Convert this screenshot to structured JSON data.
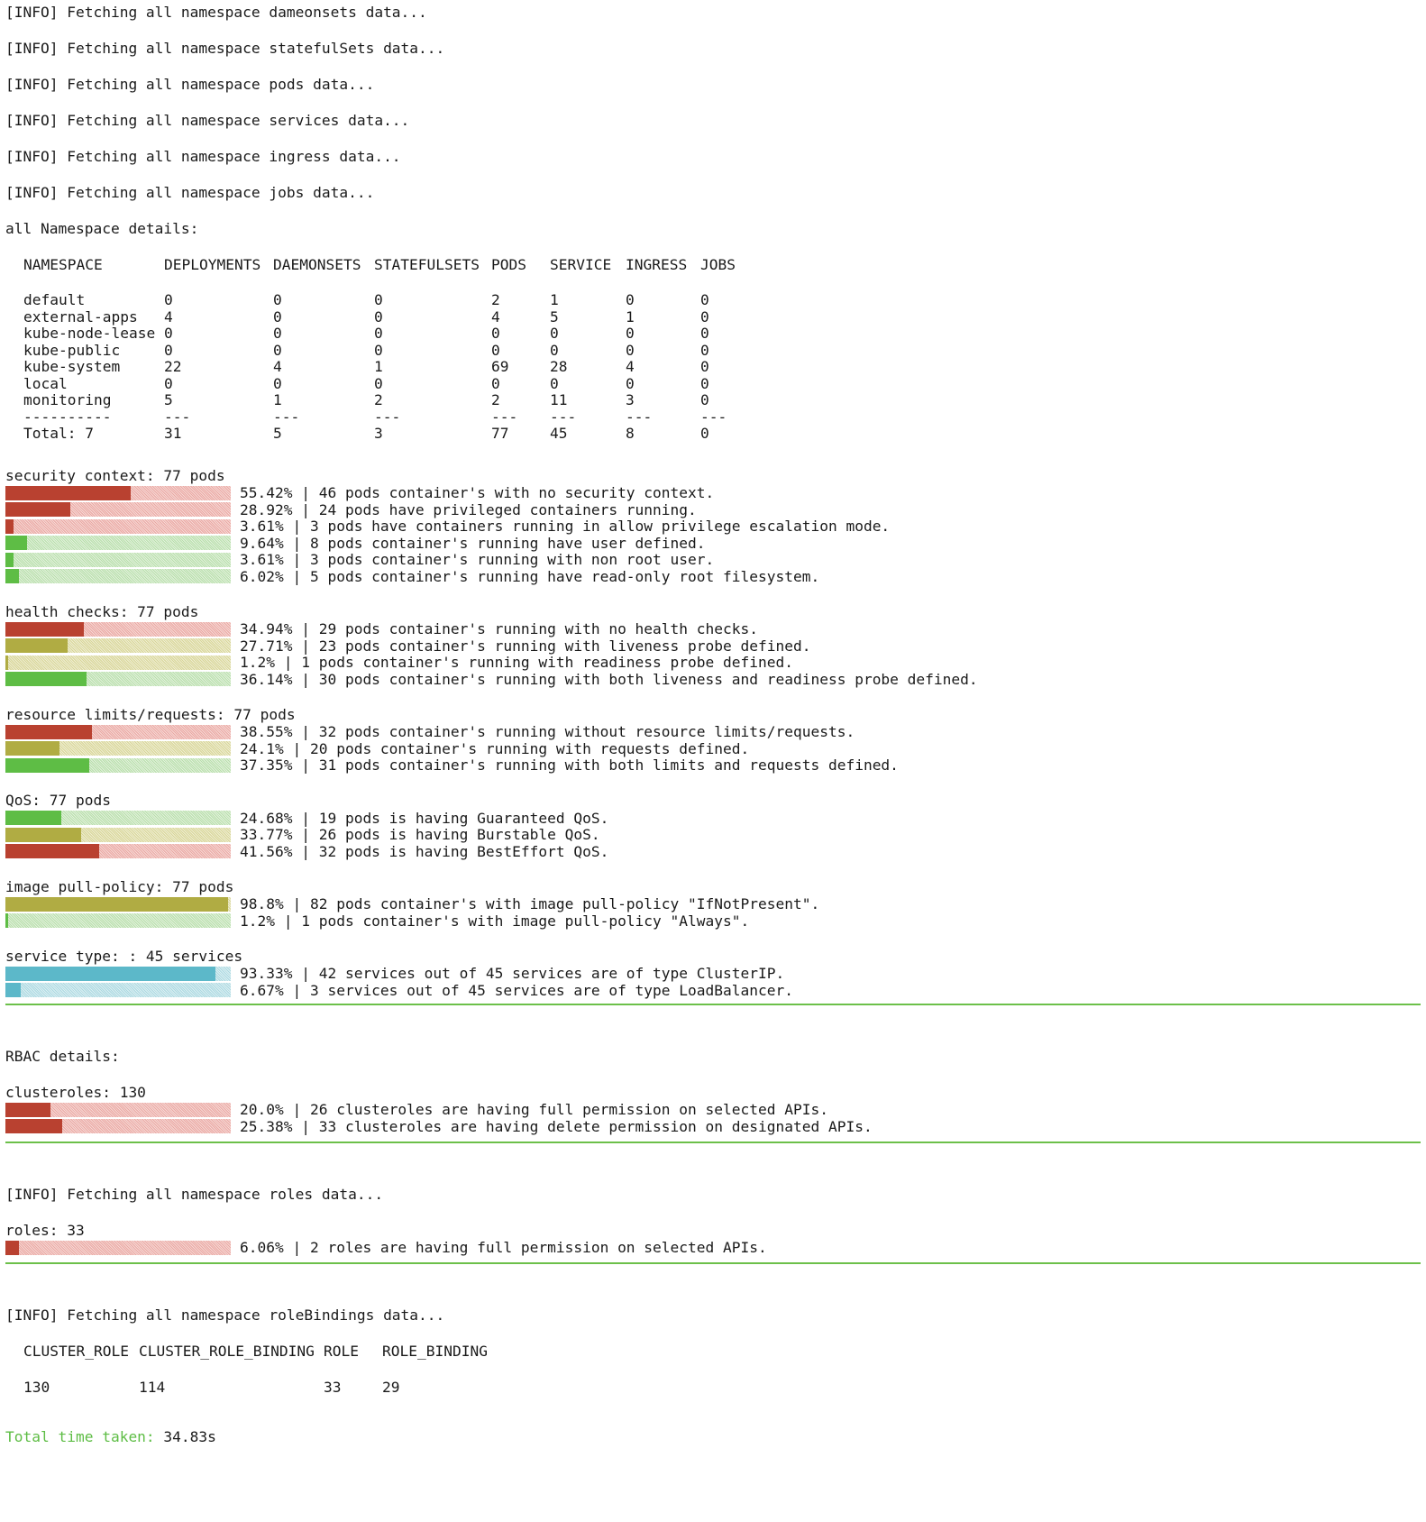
{
  "colors": {
    "red": "#b94130",
    "green": "#5ebd45",
    "olive": "#b0ac43",
    "cyan": "#5cb8c9",
    "separator": "#6cc04a"
  },
  "info_lines": [
    "[INFO] Fetching all namespace dameonsets data...",
    "[INFO] Fetching all namespace statefulSets data...",
    "[INFO] Fetching all namespace pods data...",
    "[INFO] Fetching all namespace services data...",
    "[INFO] Fetching all namespace ingress data...",
    "[INFO] Fetching all namespace jobs data..."
  ],
  "ns_title": "all Namespace details:",
  "ns_table": {
    "headers": [
      "NAMESPACE",
      "DEPLOYMENTS",
      "DAEMONSETS",
      "STATEFULSETS",
      "PODS",
      "SERVICE",
      "INGRESS",
      "JOBS"
    ],
    "rows": [
      [
        "default",
        "0",
        "0",
        "0",
        "2",
        "1",
        "0",
        "0"
      ],
      [
        "external-apps",
        "4",
        "0",
        "0",
        "4",
        "5",
        "1",
        "0"
      ],
      [
        "kube-node-lease",
        "0",
        "0",
        "0",
        "0",
        "0",
        "0",
        "0"
      ],
      [
        "kube-public",
        "0",
        "0",
        "0",
        "0",
        "0",
        "0",
        "0"
      ],
      [
        "kube-system",
        "22",
        "4",
        "1",
        "69",
        "28",
        "4",
        "0"
      ],
      [
        "local",
        "0",
        "0",
        "0",
        "0",
        "0",
        "0",
        "0"
      ],
      [
        "monitoring",
        "5",
        "1",
        "2",
        "2",
        "11",
        "3",
        "0"
      ]
    ],
    "dashes": [
      "----------",
      "---",
      "---",
      "---",
      "---",
      "---",
      "---",
      "---"
    ],
    "totals": [
      "Total: 7",
      "31",
      "5",
      "3",
      "77",
      "45",
      "8",
      "0"
    ]
  },
  "sections": [
    {
      "title": "security context: 77 pods",
      "rows": [
        {
          "pct": 55.42,
          "color": "red",
          "text": "55.42% | 46 pods container's with no security context."
        },
        {
          "pct": 28.92,
          "color": "red",
          "text": "28.92% | 24 pods have privileged containers running."
        },
        {
          "pct": 3.61,
          "color": "red",
          "text": "3.61% | 3 pods have containers running in allow privilege escalation mode."
        },
        {
          "pct": 9.64,
          "color": "green",
          "text": "9.64% | 8 pods container's running have user defined."
        },
        {
          "pct": 3.61,
          "color": "green",
          "text": "3.61% | 3 pods container's running with non root user."
        },
        {
          "pct": 6.02,
          "color": "green",
          "text": "6.02% | 5 pods container's running have read-only root filesystem."
        }
      ]
    },
    {
      "title": "health checks: 77 pods",
      "rows": [
        {
          "pct": 34.94,
          "color": "red",
          "text": "34.94% | 29 pods container's running with no health checks."
        },
        {
          "pct": 27.71,
          "color": "olive",
          "text": "27.71% | 23 pods container's running with liveness probe defined."
        },
        {
          "pct": 1.2,
          "color": "olive",
          "text": "1.2% | 1 pods container's running with readiness probe defined."
        },
        {
          "pct": 36.14,
          "color": "green",
          "text": "36.14% | 30 pods container's running with both liveness and readiness probe defined."
        }
      ]
    },
    {
      "title": "resource limits/requests: 77 pods",
      "rows": [
        {
          "pct": 38.55,
          "color": "red",
          "text": "38.55% | 32 pods container's running without resource limits/requests."
        },
        {
          "pct": 24.1,
          "color": "olive",
          "text": "24.1% | 20 pods container's running with requests defined."
        },
        {
          "pct": 37.35,
          "color": "green",
          "text": "37.35% | 31 pods container's running with both limits and requests defined."
        }
      ]
    },
    {
      "title": "QoS: 77 pods",
      "rows": [
        {
          "pct": 24.68,
          "color": "green",
          "text": "24.68% | 19 pods is having Guaranteed QoS."
        },
        {
          "pct": 33.77,
          "color": "olive",
          "text": "33.77% | 26 pods is having Burstable QoS."
        },
        {
          "pct": 41.56,
          "color": "red",
          "text": "41.56% | 32 pods is having BestEffort QoS."
        }
      ]
    },
    {
      "title": "image pull-policy: 77 pods",
      "rows": [
        {
          "pct": 98.8,
          "color": "olive",
          "text": "98.8% | 82 pods container's with image pull-policy \"IfNotPresent\"."
        },
        {
          "pct": 1.2,
          "color": "green",
          "text": "1.2% | 1 pods container's with image pull-policy \"Always\"."
        }
      ]
    },
    {
      "title": "service type: : 45 services",
      "rows": [
        {
          "pct": 93.33,
          "color": "cyan",
          "text": "93.33% | 42 services out of 45 services are of type ClusterIP."
        },
        {
          "pct": 6.67,
          "color": "cyan",
          "text": "6.67% | 3 services out of 45 services are of type LoadBalancer."
        }
      ]
    }
  ],
  "rbac_title": "RBAC details:",
  "clusterroles": {
    "title": "clusteroles: 130",
    "rows": [
      {
        "pct": 20.0,
        "color": "red",
        "text": "20.0% | 26 clusteroles are having full permission on selected APIs."
      },
      {
        "pct": 25.38,
        "color": "red",
        "text": "25.38% | 33 clusteroles are having delete permission on designated APIs."
      }
    ]
  },
  "roles_info": "[INFO] Fetching all namespace roles data...",
  "roles": {
    "title": "roles: 33",
    "rows": [
      {
        "pct": 6.06,
        "color": "red",
        "text": "6.06% | 2 roles are having full permission on selected APIs."
      }
    ]
  },
  "rolebindings_info": "[INFO] Fetching all namespace roleBindings data...",
  "binding_table": {
    "headers": [
      "CLUSTER_ROLE",
      "CLUSTER_ROLE_BINDING",
      "ROLE",
      "ROLE_BINDING"
    ],
    "values": [
      "130",
      "114",
      "33",
      "29"
    ]
  },
  "total_label": "Total time taken:",
  "total_value": " 34.83s"
}
